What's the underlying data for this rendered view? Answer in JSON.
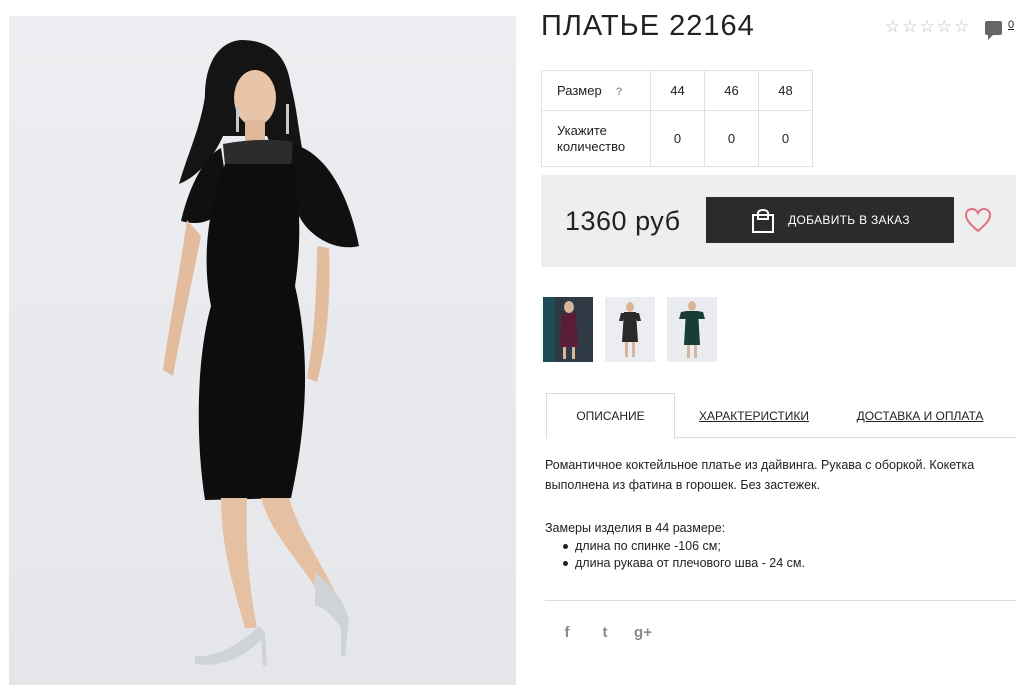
{
  "product": {
    "title": "ПЛАТЬЕ 22164",
    "rating_stars": 5,
    "rating_value": 0,
    "comments_count": "0"
  },
  "sizes": {
    "size_label": "Размер",
    "help": "?",
    "qty_label": "Укажите количество",
    "columns": [
      "44",
      "46",
      "48"
    ],
    "quantities": [
      "0",
      "0",
      "0"
    ]
  },
  "buy": {
    "price": "1360 руб",
    "order_label": "ДОБАВИТЬ В ЗАКАЗ",
    "favorite_icon": "heart-icon",
    "favorite_color": "#e07080"
  },
  "thumbnails": [
    {
      "name": "burgundy-dress",
      "color": "#5a1d36"
    },
    {
      "name": "black-dress-studio",
      "color": "#2a2a2a"
    },
    {
      "name": "green-dress",
      "color": "#173d36"
    }
  ],
  "tabs": [
    {
      "label": "ОПИСАНИЕ",
      "active": true
    },
    {
      "label": "ХАРАКТЕРИСТИКИ",
      "active": false
    },
    {
      "label": "ДОСТАВКА И ОПЛАТА",
      "active": false
    }
  ],
  "description": {
    "text": "Романтичное коктейльное платье из дайвинга. Рукава с оборкой. Кокетка выполнена из фатина в горошек. Без застежек.",
    "measurements_title": "Замеры изделия в 44 размере:",
    "measurements": [
      "длина по спинке -106 см;",
      "длина рукава от плечового шва - 24 см."
    ]
  },
  "social": {
    "facebook": "f",
    "twitter": "t",
    "googleplus": "g+"
  }
}
